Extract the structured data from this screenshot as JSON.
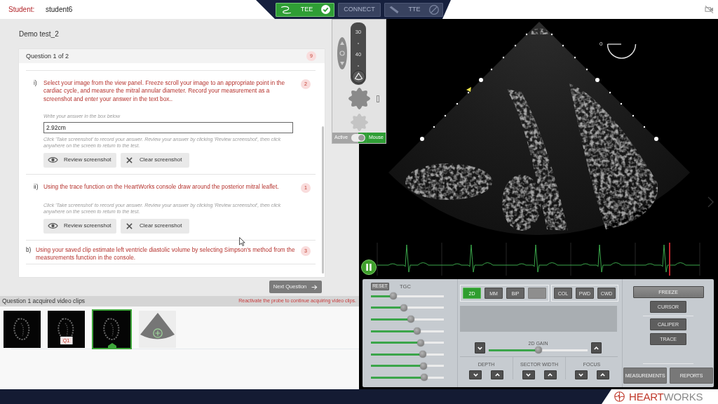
{
  "top_bar": {
    "student_label": "Student:",
    "student_name": "student6",
    "probe_tabs": [
      {
        "kind": "cable",
        "label": "TEE",
        "selected": true
      },
      {
        "kind": "action",
        "label": "CONNECT",
        "selected": false
      },
      {
        "kind": "handheld",
        "label": "TTE",
        "selected": false
      }
    ]
  },
  "test": {
    "title": "Demo test_2",
    "question_header": "Question 1 of 2",
    "question_badge": "9",
    "parts": [
      {
        "kind": "sub",
        "marker": "i)",
        "text": "Select your image from the view panel. Freeze scroll your image to an appropriate point in the cardiac cycle, and measure the mitral annular diameter. Record your measurement as a screenshot and enter your answer in the text box..",
        "badge": "2",
        "answer_hint": "Write your answer in the box below",
        "answer": "2.92cm",
        "note": "Click 'Take screenshot' to record your answer. Review your answer by clicking 'Review screenshot', then click anywhere on the screen to return to the test.",
        "buttons": [
          {
            "kind": "review",
            "label": "Review screenshot"
          },
          {
            "kind": "clear",
            "label": "Clear screenshot"
          }
        ]
      },
      {
        "kind": "sub",
        "marker": "ii)",
        "text": "Using the trace function on the HeartWorks console draw around the posterior mitral leaflet.",
        "badge": "1",
        "note": "Click 'Take screenshot' to record your answer. Review your answer by clicking 'Review screenshot', then click anywhere on the screen to return to the test.",
        "buttons": [
          {
            "kind": "review",
            "label": "Review screenshot"
          },
          {
            "kind": "clear",
            "label": "Clear screenshot"
          }
        ]
      },
      {
        "kind": "main",
        "marker": "b)",
        "text": "Using your saved clip estimate left ventricle diastolic volume by selecting Simpson's method from the measurements function in the console.",
        "badge": "3"
      }
    ],
    "next_button": "Next Question"
  },
  "clips": {
    "title": "Question 1 acquired video clips",
    "notice": "Reactivate the probe to continue acquiring video clips.",
    "items": [
      {
        "selected": false
      },
      {
        "selected": false,
        "tag": "Q1"
      },
      {
        "selected": true
      }
    ]
  },
  "probe_panel": {
    "scale_labels": [
      "30",
      "40"
    ],
    "toggle": {
      "left_label": "Active",
      "right_label": "Mouse",
      "on": true
    }
  },
  "imaging": {
    "angle": "0"
  },
  "console": {
    "reset_button": "RESET",
    "tgc_label": "TGC",
    "tgc": [
      {
        "level": 0.31
      },
      {
        "level": 0.45
      },
      {
        "level": 0.55
      },
      {
        "level": 0.63
      },
      {
        "level": 0.68
      },
      {
        "level": 0.71
      },
      {
        "level": 0.72
      },
      {
        "level": 0.73
      }
    ],
    "mode_groups": [
      [
        {
          "label": "2D",
          "selected": true,
          "disabled": false
        },
        {
          "label": "MM",
          "selected": false,
          "disabled": false
        },
        {
          "label": "BiP",
          "selected": false,
          "disabled": false
        },
        {
          "selected": false,
          "disabled": true
        }
      ],
      [
        {
          "label": "COL",
          "selected": false,
          "disabled": false
        },
        {
          "label": "PWD",
          "selected": false,
          "disabled": false
        },
        {
          "label": "CWD",
          "selected": false,
          "disabled": false
        }
      ]
    ],
    "gain": {
      "label": "2D GAIN",
      "level": 0.5
    },
    "steppers": [
      "DEPTH",
      "SECTOR WIDTH",
      "FOCUS"
    ],
    "actions": [
      [
        "FREEZE",
        "CURSOR"
      ],
      [
        "CALIPER",
        "TRACE"
      ],
      [
        "MEASUREMENTS",
        "REPORTS"
      ]
    ]
  },
  "footer": {
    "logo": [
      "HEART",
      "WORKS"
    ]
  }
}
